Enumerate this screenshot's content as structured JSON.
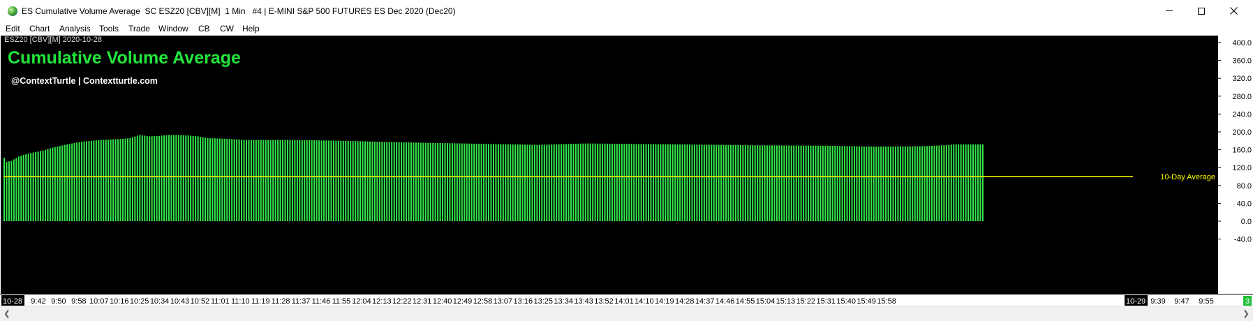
{
  "window": {
    "title": "ES Cumulative Volume Average  SC ESZ20 [CBV][M]  1 Min   #4 | E-MINI S&P 500 FUTURES ES Dec 2020 (Dec20)",
    "icon": "globe-icon"
  },
  "menu": {
    "items": [
      "Edit",
      "Chart",
      "Analysis",
      "Tools",
      "Trade",
      "Window",
      "CB",
      "CW",
      "Help"
    ]
  },
  "chart": {
    "symbol_label": "ESZ20 [CBV][M]  2020-10-28",
    "title": "Cumulative Volume Average",
    "subtitle": "@ContextTurtle | Contextturtle.com",
    "badge": "3"
  },
  "colors": {
    "background": "#000000",
    "bars": "#33e84c",
    "reference_line": "#ffff00",
    "title": "#22e63c"
  },
  "chart_data": {
    "type": "bar",
    "title": "Cumulative Volume Average",
    "y_ticks": [
      "400.0",
      "360.0",
      "320.0",
      "280.0",
      "240.0",
      "200.0",
      "160.0",
      "120.0",
      "80.0",
      "40.0",
      "0.0",
      "-40.0"
    ],
    "y_tick_values": [
      400,
      360,
      320,
      280,
      240,
      200,
      160,
      120,
      80,
      40,
      0,
      -40
    ],
    "ylim": [
      -60,
      423
    ],
    "x_tick_labels": [
      "10-28",
      "9:42",
      "9:50",
      "9:58",
      "10:07",
      "10:16",
      "10:25",
      "10:34",
      "10:43",
      "10:52",
      "11:01",
      "11:10",
      "11:19",
      "11:28",
      "11:37",
      "11:46",
      "11:55",
      "12:04",
      "12:13",
      "12:22",
      "12:31",
      "12:40",
      "12:49",
      "12:58",
      "13:07",
      "13:16",
      "13:25",
      "13:34",
      "13:43",
      "13:52",
      "14:01",
      "14:10",
      "14:19",
      "14:28",
      "14:37",
      "14:46",
      "14:55",
      "15:04",
      "15:13",
      "15:22",
      "15:31",
      "15:40",
      "15:49",
      "15:58",
      "10-29",
      "9:39",
      "9:47",
      "9:55"
    ],
    "highlighted_x_labels": [
      "10-28",
      "10-29"
    ],
    "reference_line": {
      "label": "10-Day Average",
      "value": 100
    },
    "grid": false,
    "bar_count": 405,
    "profile_knots": [
      [
        0,
        142
      ],
      [
        1,
        133
      ],
      [
        3,
        135
      ],
      [
        6,
        145
      ],
      [
        9,
        150
      ],
      [
        13,
        155
      ],
      [
        16,
        158
      ],
      [
        20,
        165
      ],
      [
        26,
        172
      ],
      [
        32,
        178
      ],
      [
        40,
        182
      ],
      [
        48,
        184
      ],
      [
        52,
        186
      ],
      [
        56,
        193
      ],
      [
        60,
        190
      ],
      [
        64,
        191
      ],
      [
        68,
        193
      ],
      [
        72,
        193
      ],
      [
        76,
        192
      ],
      [
        80,
        190
      ],
      [
        84,
        186
      ],
      [
        90,
        185
      ],
      [
        100,
        182
      ],
      [
        120,
        182
      ],
      [
        140,
        180
      ],
      [
        170,
        176
      ],
      [
        200,
        173
      ],
      [
        220,
        171
      ],
      [
        240,
        174
      ],
      [
        280,
        172
      ],
      [
        310,
        170
      ],
      [
        340,
        169
      ],
      [
        360,
        167
      ],
      [
        380,
        168
      ],
      [
        388,
        170
      ],
      [
        392,
        172
      ],
      [
        396,
        172
      ],
      [
        404,
        172
      ]
    ]
  }
}
